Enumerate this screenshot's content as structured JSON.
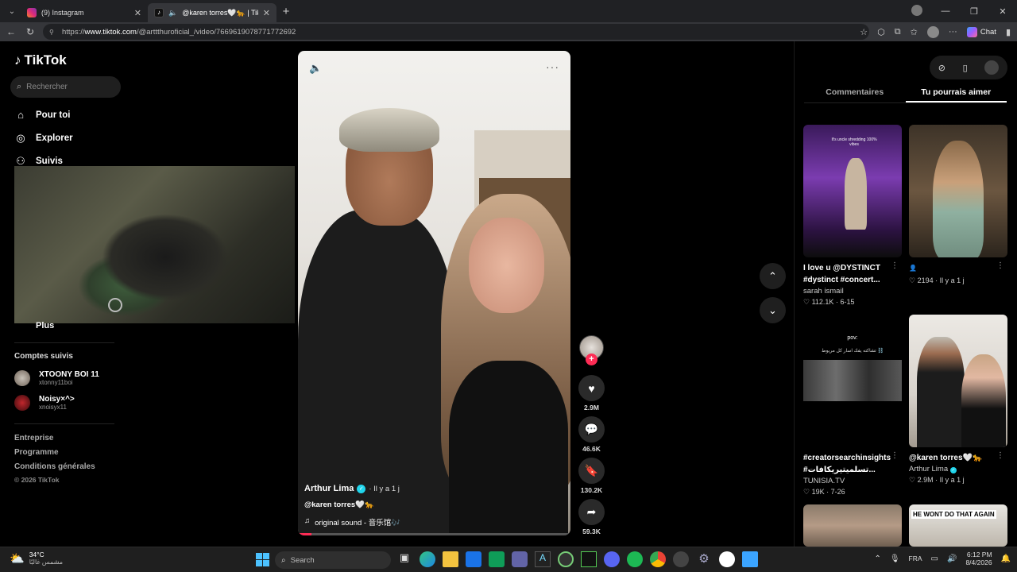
{
  "browser": {
    "tabs": [
      {
        "title": "(9) Instagram",
        "color": "#e1306c",
        "active": false
      },
      {
        "title": "@karen torres🤍🐆 | TikTok",
        "color": "#000000",
        "active": true
      }
    ],
    "url_prefix": "https://",
    "url_host": "www.tiktok.com",
    "url_path": "/@arttthuroficial_/video/7669619078771772692",
    "chat_label": "Chat"
  },
  "sidebar": {
    "logo": "TikTok",
    "search_placeholder": "Rechercher",
    "nav": [
      {
        "label": "Pour toi",
        "icon": "home-icon"
      },
      {
        "label": "Explorer",
        "icon": "compass-icon"
      },
      {
        "label": "Suivis",
        "icon": "user-follow-icon"
      }
    ],
    "more_label": "Plus",
    "following_title": "Comptes suivis",
    "following": [
      {
        "name": "XTOONY BOI 11",
        "handle": "xtonny11boi"
      },
      {
        "name": "Noisy×^>",
        "handle": "xnoisyx11"
      }
    ],
    "footer": [
      "Entreprise",
      "Programme",
      "Conditions générales"
    ],
    "copyright": "© 2026 TikTok"
  },
  "video": {
    "author": "Arthur Lima",
    "age": "· Il y a 1 j",
    "caption": "@karen torres🤍🐆",
    "sound": "original sound - 音乐馆🎶",
    "progress": 0.05
  },
  "actions": {
    "likes": "2.9M",
    "comments": "46.6K",
    "saves": "130.2K",
    "shares": "59.3K"
  },
  "right_panel": {
    "tabs": [
      "Commentaires",
      "Tu pourrais aimer"
    ],
    "active_tab": 1,
    "cards": [
      {
        "title": "I love u @DYSTINCT",
        "title2": "#dystinct #concert...",
        "author": "sarah ismail",
        "likes": "112.1K",
        "date": "6-15",
        "thumb_text": "It's uncle shredding 100% vibes"
      },
      {
        "title": "",
        "title2": "",
        "author": "",
        "likes": "2194",
        "date": "Il y a 1 j",
        "thumb_text": ""
      },
      {
        "title": "#creatorsearchinsights",
        "title2": "#تسلميتيريكافات...",
        "author": "TUNISIA.TV",
        "likes": "19K",
        "date": "7-26",
        "thumb_text": "pov:"
      },
      {
        "title": "@karen torres🤍🐆",
        "title2": "",
        "author": "Arthur Lima",
        "likes": "2.9M",
        "date": "Il y a 1 j",
        "thumb_text": ""
      },
      {
        "title": "",
        "title2": "",
        "author": "",
        "likes": "",
        "date": "",
        "thumb_text": ""
      },
      {
        "title": "",
        "title2": "",
        "author": "",
        "likes": "",
        "date": "",
        "thumb_text": "HE WONT DO THAT AGAIN"
      }
    ]
  },
  "taskbar": {
    "weather_temp": "34°C",
    "weather_desc": "مشمس غالبًا",
    "search_placeholder": "Search",
    "lang": "FRA",
    "time": "6:12 PM",
    "date": "8/4/2026"
  }
}
